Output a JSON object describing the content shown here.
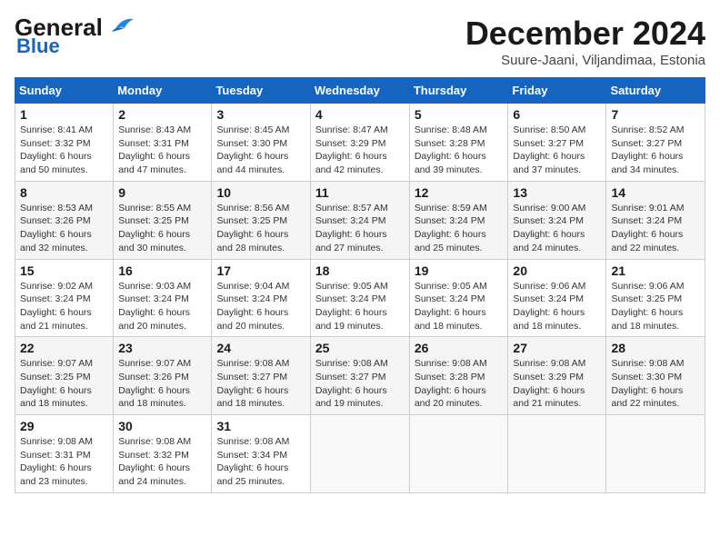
{
  "header": {
    "logo_line1": "General",
    "logo_line2": "Blue",
    "month_title": "December 2024",
    "subtitle": "Suure-Jaani, Viljandimaa, Estonia"
  },
  "days_of_week": [
    "Sunday",
    "Monday",
    "Tuesday",
    "Wednesday",
    "Thursday",
    "Friday",
    "Saturday"
  ],
  "weeks": [
    [
      {
        "day": "1",
        "sunrise": "Sunrise: 8:41 AM",
        "sunset": "Sunset: 3:32 PM",
        "daylight": "Daylight: 6 hours and 50 minutes."
      },
      {
        "day": "2",
        "sunrise": "Sunrise: 8:43 AM",
        "sunset": "Sunset: 3:31 PM",
        "daylight": "Daylight: 6 hours and 47 minutes."
      },
      {
        "day": "3",
        "sunrise": "Sunrise: 8:45 AM",
        "sunset": "Sunset: 3:30 PM",
        "daylight": "Daylight: 6 hours and 44 minutes."
      },
      {
        "day": "4",
        "sunrise": "Sunrise: 8:47 AM",
        "sunset": "Sunset: 3:29 PM",
        "daylight": "Daylight: 6 hours and 42 minutes."
      },
      {
        "day": "5",
        "sunrise": "Sunrise: 8:48 AM",
        "sunset": "Sunset: 3:28 PM",
        "daylight": "Daylight: 6 hours and 39 minutes."
      },
      {
        "day": "6",
        "sunrise": "Sunrise: 8:50 AM",
        "sunset": "Sunset: 3:27 PM",
        "daylight": "Daylight: 6 hours and 37 minutes."
      },
      {
        "day": "7",
        "sunrise": "Sunrise: 8:52 AM",
        "sunset": "Sunset: 3:27 PM",
        "daylight": "Daylight: 6 hours and 34 minutes."
      }
    ],
    [
      {
        "day": "8",
        "sunrise": "Sunrise: 8:53 AM",
        "sunset": "Sunset: 3:26 PM",
        "daylight": "Daylight: 6 hours and 32 minutes."
      },
      {
        "day": "9",
        "sunrise": "Sunrise: 8:55 AM",
        "sunset": "Sunset: 3:25 PM",
        "daylight": "Daylight: 6 hours and 30 minutes."
      },
      {
        "day": "10",
        "sunrise": "Sunrise: 8:56 AM",
        "sunset": "Sunset: 3:25 PM",
        "daylight": "Daylight: 6 hours and 28 minutes."
      },
      {
        "day": "11",
        "sunrise": "Sunrise: 8:57 AM",
        "sunset": "Sunset: 3:24 PM",
        "daylight": "Daylight: 6 hours and 27 minutes."
      },
      {
        "day": "12",
        "sunrise": "Sunrise: 8:59 AM",
        "sunset": "Sunset: 3:24 PM",
        "daylight": "Daylight: 6 hours and 25 minutes."
      },
      {
        "day": "13",
        "sunrise": "Sunrise: 9:00 AM",
        "sunset": "Sunset: 3:24 PM",
        "daylight": "Daylight: 6 hours and 24 minutes."
      },
      {
        "day": "14",
        "sunrise": "Sunrise: 9:01 AM",
        "sunset": "Sunset: 3:24 PM",
        "daylight": "Daylight: 6 hours and 22 minutes."
      }
    ],
    [
      {
        "day": "15",
        "sunrise": "Sunrise: 9:02 AM",
        "sunset": "Sunset: 3:24 PM",
        "daylight": "Daylight: 6 hours and 21 minutes."
      },
      {
        "day": "16",
        "sunrise": "Sunrise: 9:03 AM",
        "sunset": "Sunset: 3:24 PM",
        "daylight": "Daylight: 6 hours and 20 minutes."
      },
      {
        "day": "17",
        "sunrise": "Sunrise: 9:04 AM",
        "sunset": "Sunset: 3:24 PM",
        "daylight": "Daylight: 6 hours and 20 minutes."
      },
      {
        "day": "18",
        "sunrise": "Sunrise: 9:05 AM",
        "sunset": "Sunset: 3:24 PM",
        "daylight": "Daylight: 6 hours and 19 minutes."
      },
      {
        "day": "19",
        "sunrise": "Sunrise: 9:05 AM",
        "sunset": "Sunset: 3:24 PM",
        "daylight": "Daylight: 6 hours and 18 minutes."
      },
      {
        "day": "20",
        "sunrise": "Sunrise: 9:06 AM",
        "sunset": "Sunset: 3:24 PM",
        "daylight": "Daylight: 6 hours and 18 minutes."
      },
      {
        "day": "21",
        "sunrise": "Sunrise: 9:06 AM",
        "sunset": "Sunset: 3:25 PM",
        "daylight": "Daylight: 6 hours and 18 minutes."
      }
    ],
    [
      {
        "day": "22",
        "sunrise": "Sunrise: 9:07 AM",
        "sunset": "Sunset: 3:25 PM",
        "daylight": "Daylight: 6 hours and 18 minutes."
      },
      {
        "day": "23",
        "sunrise": "Sunrise: 9:07 AM",
        "sunset": "Sunset: 3:26 PM",
        "daylight": "Daylight: 6 hours and 18 minutes."
      },
      {
        "day": "24",
        "sunrise": "Sunrise: 9:08 AM",
        "sunset": "Sunset: 3:27 PM",
        "daylight": "Daylight: 6 hours and 18 minutes."
      },
      {
        "day": "25",
        "sunrise": "Sunrise: 9:08 AM",
        "sunset": "Sunset: 3:27 PM",
        "daylight": "Daylight: 6 hours and 19 minutes."
      },
      {
        "day": "26",
        "sunrise": "Sunrise: 9:08 AM",
        "sunset": "Sunset: 3:28 PM",
        "daylight": "Daylight: 6 hours and 20 minutes."
      },
      {
        "day": "27",
        "sunrise": "Sunrise: 9:08 AM",
        "sunset": "Sunset: 3:29 PM",
        "daylight": "Daylight: 6 hours and 21 minutes."
      },
      {
        "day": "28",
        "sunrise": "Sunrise: 9:08 AM",
        "sunset": "Sunset: 3:30 PM",
        "daylight": "Daylight: 6 hours and 22 minutes."
      }
    ],
    [
      {
        "day": "29",
        "sunrise": "Sunrise: 9:08 AM",
        "sunset": "Sunset: 3:31 PM",
        "daylight": "Daylight: 6 hours and 23 minutes."
      },
      {
        "day": "30",
        "sunrise": "Sunrise: 9:08 AM",
        "sunset": "Sunset: 3:32 PM",
        "daylight": "Daylight: 6 hours and 24 minutes."
      },
      {
        "day": "31",
        "sunrise": "Sunrise: 9:08 AM",
        "sunset": "Sunset: 3:34 PM",
        "daylight": "Daylight: 6 hours and 25 minutes."
      },
      null,
      null,
      null,
      null
    ]
  ]
}
